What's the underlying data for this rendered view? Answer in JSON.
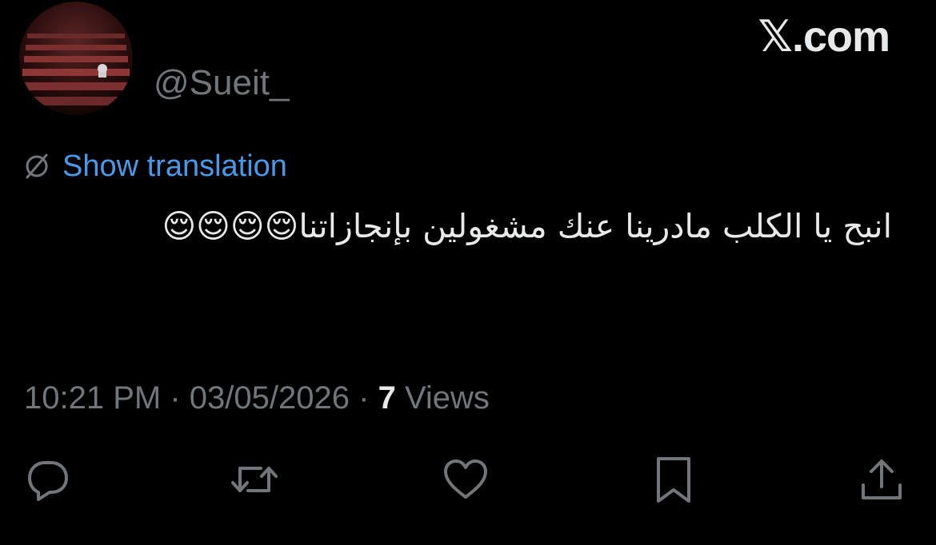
{
  "header": {
    "handle": "@Sueit_",
    "brand": "𝕏.com",
    "avatar_icon": "profile-avatar-theater-seats"
  },
  "translation": {
    "icon": "globe-icon",
    "label": "Show translation"
  },
  "tweet": {
    "text": "انبح يا الكلب مادرينا عنك مشغولين بإنجازاتنا😌😌😌😌"
  },
  "meta": {
    "time": "10:21 PM",
    "separator": "·",
    "date": "03/05/2026",
    "views_count": "7",
    "views_label": "Views"
  },
  "actions": {
    "reply_icon": "reply-icon",
    "retweet_icon": "retweet-icon",
    "like_icon": "heart-icon",
    "bookmark_icon": "bookmark-icon",
    "share_icon": "share-icon"
  },
  "colors": {
    "background": "#000000",
    "primary_text": "#e7e9ea",
    "secondary_text": "#71767b",
    "link": "#4a99e9"
  }
}
